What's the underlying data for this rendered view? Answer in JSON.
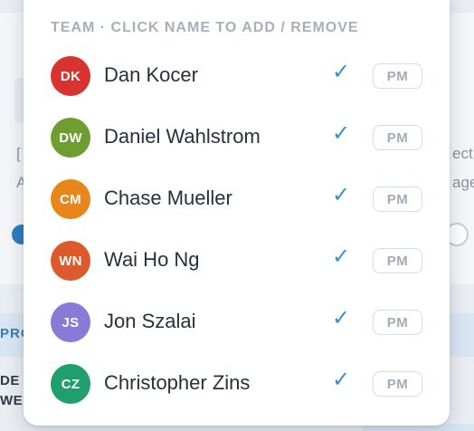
{
  "background": {
    "left_fragments": [
      "[",
      "A"
    ],
    "right_fragments": [
      "ect",
      "age"
    ],
    "section_label": "PRO",
    "row_labels": [
      "DE",
      "WE"
    ]
  },
  "team_menu": {
    "header": "TEAM · CLICK NAME TO ADD / REMOVE",
    "members": [
      {
        "initials": "DK",
        "name": "Dan Kocer",
        "check": "✓",
        "role": "PM",
        "avatar_color": "#d8332f"
      },
      {
        "initials": "DW",
        "name": "Daniel Wahlstrom",
        "check": "✓",
        "role": "PM",
        "avatar_color": "#6e9e2f"
      },
      {
        "initials": "CM",
        "name": "Chase Mueller",
        "check": "✓",
        "role": "PM",
        "avatar_color": "#e8861c"
      },
      {
        "initials": "WN",
        "name": "Wai Ho Ng",
        "check": "✓",
        "role": "PM",
        "avatar_color": "#dc5a2c"
      },
      {
        "initials": "JS",
        "name": "Jon Szalai",
        "check": "✓",
        "role": "PM",
        "avatar_color": "#8a7ad8"
      },
      {
        "initials": "CZ",
        "name": "Christopher Zins",
        "check": "✓",
        "role": "PM",
        "avatar_color": "#1f9e6e"
      }
    ]
  }
}
